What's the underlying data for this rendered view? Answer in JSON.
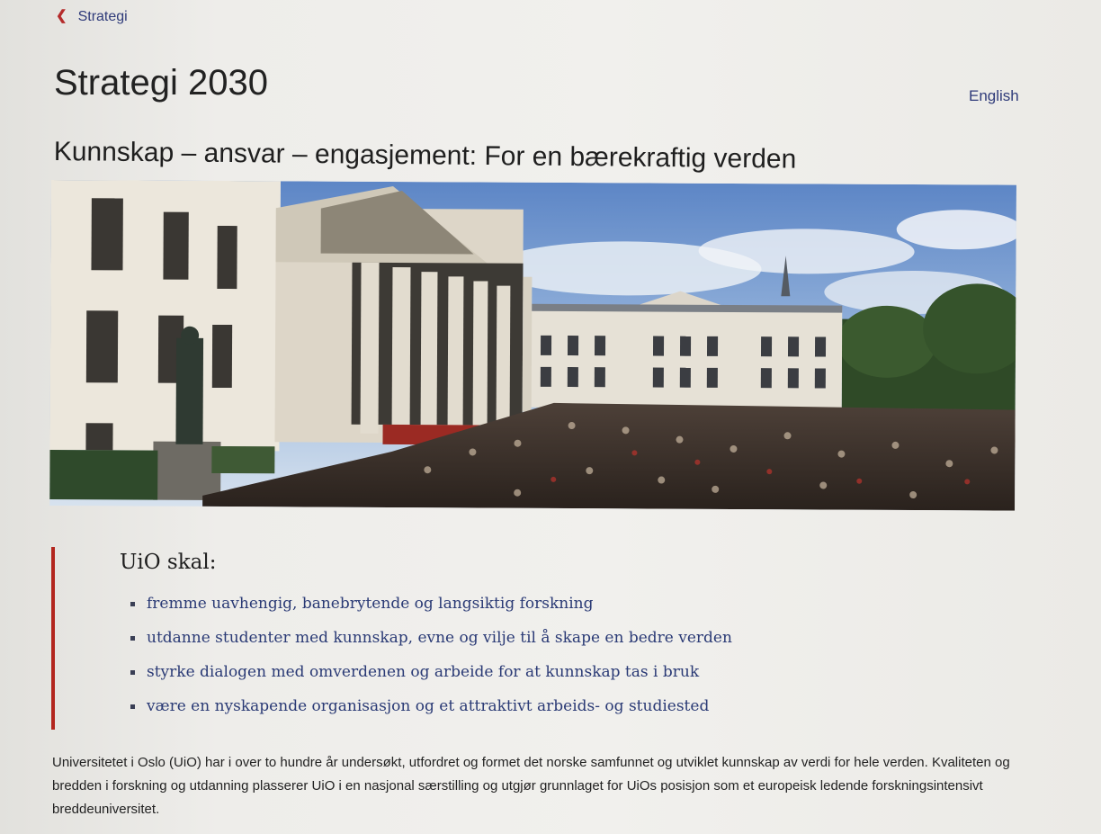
{
  "breadcrumb": {
    "chevron_icon": "chevron-left-icon",
    "label": "Strategi"
  },
  "page_title": "Strategi 2030",
  "language_link": "English",
  "subtitle": "Kunnskap – ansvar – engasjement: For en bærekraftig verden",
  "hero": {
    "image": "university-main-building-crowd-photo"
  },
  "mission": {
    "heading": "UiO skal:",
    "items": [
      "fremme uavhengig, banebrytende og langsiktig forskning",
      "utdanne studenter med kunnskap, evne og vilje til å skape en bedre verden",
      "styrke dialogen med omverdenen og arbeide for at kunnskap tas i bruk",
      "være en nyskapende organisasjon og et attraktivt arbeids- og studiested"
    ],
    "accent_color": "#b3261e"
  },
  "intro_text": "Universitetet i Oslo (UiO) har i over to hundre år undersøkt, utfordret og formet det norske samfunnet og utviklet kunnskap av verdi for hele verden. Kvaliteten og bredden i forskning og utdanning plasserer UiO i en nasjonal særstilling og utgjør grunnlaget for UiOs posisjon som et europeisk ledende forskningsintensivt breddeuniversitet.",
  "colors": {
    "link": "#2f3b7a",
    "accent": "#b3261e"
  }
}
